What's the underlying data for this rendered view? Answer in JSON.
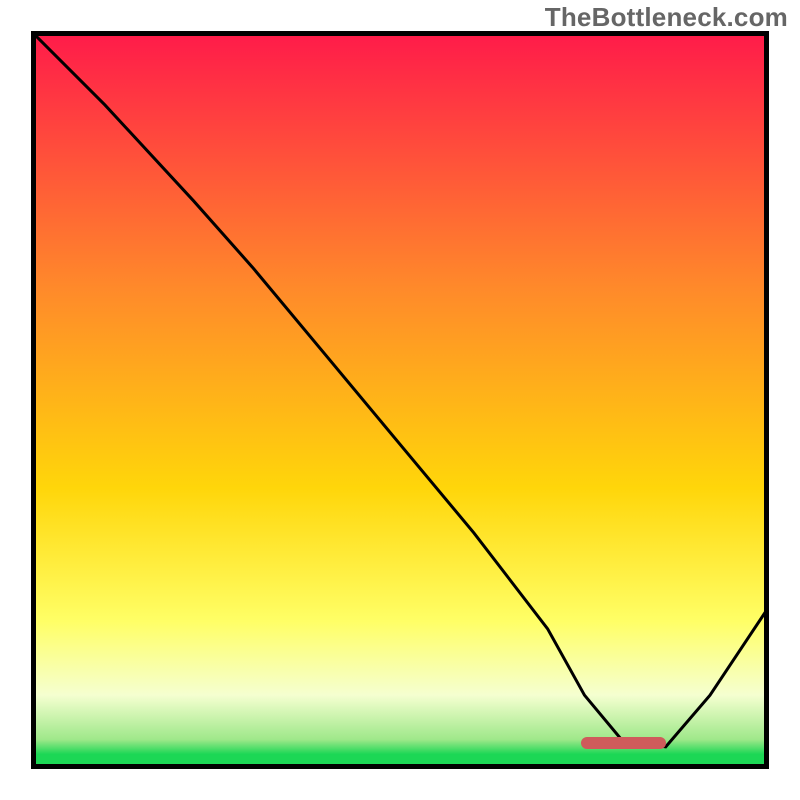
{
  "watermark": "TheBottleneck.com",
  "colors": {
    "top": "#ff1a4a",
    "mid_upper": "#ff8a2a",
    "mid": "#ffd60a",
    "mid_lower": "#ffff66",
    "pale": "#f5ffd0",
    "green": "#1cd755",
    "border": "#000000",
    "curve": "#000000",
    "marker": "#cf5b5b"
  },
  "gradient_stops": [
    {
      "pct": 0,
      "color": "#ff1a4a"
    },
    {
      "pct": 35,
      "color": "#ff8a2a"
    },
    {
      "pct": 62,
      "color": "#ffd60a"
    },
    {
      "pct": 80,
      "color": "#ffff66"
    },
    {
      "pct": 90,
      "color": "#f5ffd0"
    },
    {
      "pct": 96,
      "color": "#9fe88a"
    },
    {
      "pct": 98,
      "color": "#1cd755"
    },
    {
      "pct": 100,
      "color": "#1cd755"
    }
  ],
  "marker": {
    "x_start_frac": 0.745,
    "x_end_frac": 0.86,
    "y_frac": 0.965
  },
  "chart_data": {
    "type": "line",
    "title": "",
    "xlabel": "",
    "ylabel": "",
    "xlim": [
      0,
      100
    ],
    "ylim": [
      0,
      100
    ],
    "grid": false,
    "legend": false,
    "series": [
      {
        "name": "bottleneck-curve",
        "x": [
          0,
          10,
          22,
          30,
          40,
          50,
          60,
          70,
          75,
          80,
          86,
          92,
          100
        ],
        "y": [
          100,
          90,
          77,
          68,
          56,
          44,
          32,
          19,
          10,
          4,
          3,
          10,
          22
        ]
      }
    ],
    "annotations": [
      {
        "type": "marker-bar",
        "x_start": 74.5,
        "x_end": 86,
        "y": 3.5
      }
    ]
  }
}
